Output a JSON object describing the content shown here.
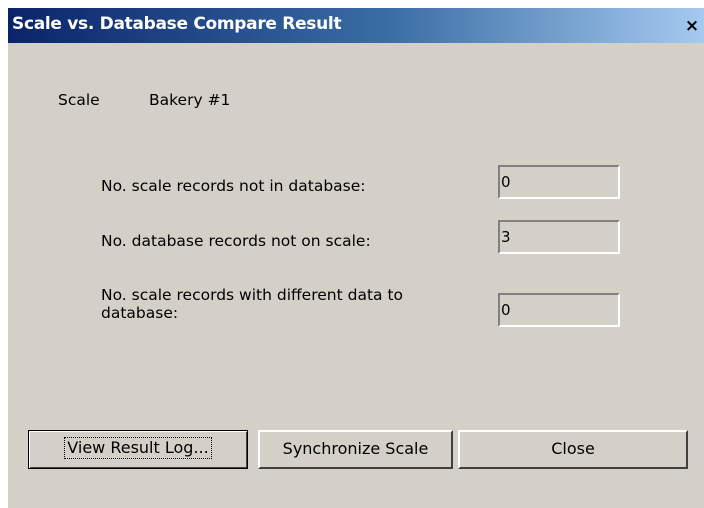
{
  "window": {
    "title": "Scale vs. Database Compare Result",
    "close_glyph": "×",
    "accent_color": "#0a246a"
  },
  "scale": {
    "label": "Scale",
    "name": "Bakery #1"
  },
  "results": {
    "not_in_database_label": "No. scale records not in database:",
    "not_in_database_value": "0",
    "not_on_scale_label": "No. database records not on scale:",
    "not_on_scale_value": "3",
    "different_data_label": "No. scale records with different data to database:",
    "different_data_value": "0"
  },
  "buttons": {
    "view_log": "View Result Log...",
    "synchronize": "Synchronize Scale",
    "close": "Close"
  }
}
